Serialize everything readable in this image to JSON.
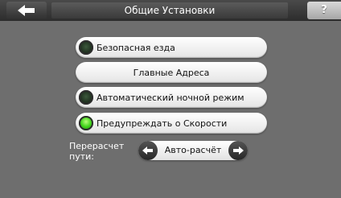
{
  "header": {
    "title": "Общие Установки",
    "back_icon": "arrow-left-icon",
    "help_label": "?"
  },
  "options": [
    {
      "label": "Безопасная езда",
      "type": "toggle",
      "state": "off"
    },
    {
      "label": "Главные Адреса",
      "type": "button"
    },
    {
      "label": "Автоматический ночной режим",
      "type": "toggle",
      "state": "off"
    },
    {
      "label": "Предупреждать о Скорости",
      "type": "toggle",
      "state": "on"
    }
  ],
  "route_recalc": {
    "label": "Перерасчет пути:",
    "value": "Авто-расчёт"
  },
  "colors": {
    "background": "#6e6e6e",
    "led_on": "#3fd31a",
    "led_off": "#1f2f1f"
  }
}
